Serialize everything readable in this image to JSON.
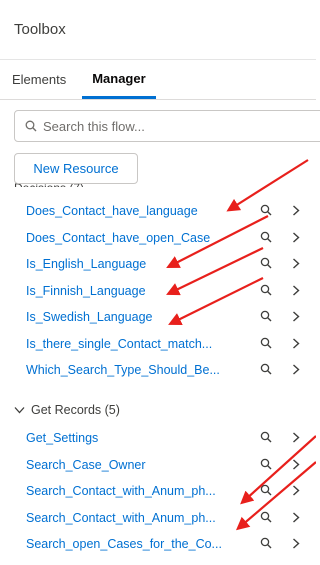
{
  "header": {
    "title": "Toolbox"
  },
  "tabs": [
    {
      "label": "Elements",
      "active": false
    },
    {
      "label": "Manager",
      "active": true
    }
  ],
  "search": {
    "placeholder": "Search this flow..."
  },
  "new_resource_label": "New Resource",
  "decisions": {
    "header_partial": "Decisions (7)",
    "items": [
      "Does_Contact_have_language",
      "Does_Contact_have_open_Case",
      "Is_English_Language",
      "Is_Finnish_Language",
      "Is_Swedish_Language",
      "Is_there_single_Contact_match...",
      "Which_Search_Type_Should_Be..."
    ]
  },
  "get_records": {
    "header": "Get Records (5)",
    "items": [
      "Get_Settings",
      "Search_Case_Owner",
      "Search_Contact_with_Anum_ph...",
      "Search_Contact_with_Anum_ph...",
      "Search_open_Cases_for_the_Co..."
    ]
  },
  "colors": {
    "link": "#0070d2",
    "arrow": "#e8201c",
    "tab_active": "#0070d2"
  },
  "icons": {
    "row_search": "search-icon",
    "row_chevron": "chevron-right-icon",
    "section": "chevron-down-icon"
  }
}
